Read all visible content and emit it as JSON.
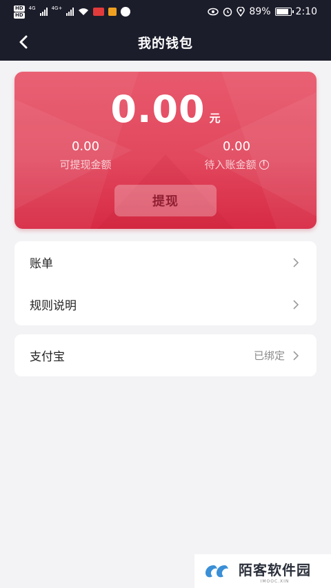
{
  "status_bar": {
    "hd_top": "HD",
    "hd_bottom": "HD",
    "net1": "4G",
    "net2": "4G+",
    "app_badge": "",
    "battery": "89%",
    "time": "2:10"
  },
  "header": {
    "title": "我的钱包"
  },
  "wallet": {
    "balance": "0.00",
    "unit": "元",
    "withdrawable_amount": "0.00",
    "withdrawable_label": "可提现金额",
    "pending_amount": "0.00",
    "pending_label": "待入账金额",
    "info_icon_glyph": "!",
    "withdraw_button": "提现"
  },
  "menu": {
    "items": [
      {
        "label": "账单"
      },
      {
        "label": "规则说明"
      }
    ],
    "alipay": {
      "label": "支付宝",
      "status": "已绑定"
    }
  },
  "watermark": {
    "text": "陌客软件园",
    "sub": "IMOOC.XIN"
  },
  "colors": {
    "header_bg": "#1c1d2b",
    "card_top": "#e8596d",
    "card_bottom": "#d72a44",
    "page_bg": "#f3f3f5"
  },
  "icons": [
    "back-icon",
    "info-icon",
    "chevron-right-icon",
    "eye-icon",
    "alarm-icon",
    "location-icon",
    "wifi-icon",
    "battery-icon"
  ]
}
